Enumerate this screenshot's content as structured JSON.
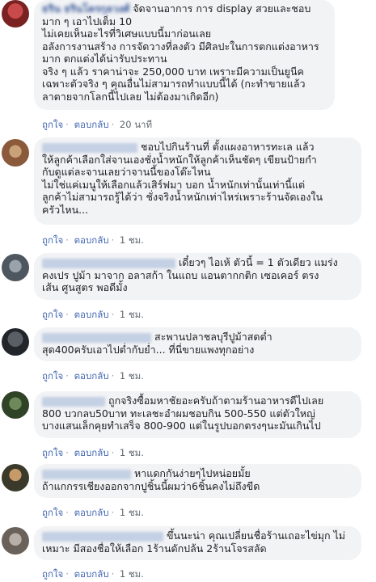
{
  "comments": [
    {
      "author": "ธริน ธรินโครกุลวงศ์",
      "text": "จัดจานอาการ การ display สวยและชอบ\nมาก ๆ เอาไปเต็ม 10\nไม่เคยเห็นอะไรที่วิเศษแบบนี้มาก่อนเลย\nอลังการงานสร้าง การจัดวางที่ลงตัว มีศิลปะในการตกแต่งอาหาร\nมาก ตกแต่งได้น่ารับประทาน\nจริง ๆ แล้ว ราคาน่าจะ 250,000 บาท เพราะมีความเป็นยูนีค\nเฉพาะตัวจริง ๆ คุณอื่นไม่สามารถทำแบบนี้ได้ (กะทำขายแล้ว\nลาตายจากโลกนี้ไปเลย ไม่ต้องมาเกิดอีก)",
      "like": "ถูกใจ",
      "reply": "ตอบกลับ",
      "time": "20 นาที"
    },
    {
      "author": "",
      "text": "ชอบไปกินร้านที่ ตั้งแผงอาหารทะเล แล้ว\nให้ลูกค้าเลือกใส่จานเองชั่งน้ำหนักให้ลูกค้าเห็นชัดๆ เขียนป้ายกำ\nกับดูแต่ละจานเลยว่าจานนี้ของโต๊ะไหน\nไม่ใช่แค่เมนูให้เลือกแล้วเสิร์ฟมา บอก น้ำหนักเท่านั้นเท่านี้แต่\nลูกค้าไม่สามารถรู้ได้ว่า ชั่งจริงน้ำหนักเท่าไหร่เพราะร้านจัดเองใน\nครัวไหน...",
      "like": "ถูกใจ",
      "reply": "ตอบกลับ",
      "time": "1 ชม."
    },
    {
      "author": "",
      "text": "เดี๋ยวๆ ไอเห้ ตัวนี้ = 1 ตัวเดียว แมร่ง\nคงเปร ปูม้า มาจาก อลาสก้า ในแถบ แอนตากกติก เซอเคอร์ ตรง\nเส้น ศูนสูตร พอดีมั้ง",
      "like": "ถูกใจ",
      "reply": "ตอบกลับ",
      "time": "1 ชม."
    },
    {
      "author": "",
      "text": "สะพานปลาชลบุรีปูม้าสดต่ำ\nสุด400ครับเอาไปต่ำกับย่ำ... ที่นี่ขายแพงทุกอย่าง",
      "like": "ถูกใจ",
      "reply": "ตอบกลับ",
      "time": "1 ชม."
    },
    {
      "author": "",
      "text": "ถูกจริงซื้อมหาชัยอะครับถ้าตามร้านอาหารดีไปเลย\n800 บวกลบ50บาท ทะเลชะอำผมชอบกิน 500-550 แต่ตัวใหญ่\nบางแสนเล็กคุยทำเสร็จ 800-900 แต่ในรูปบอกตรงๆนะมันเกินไป",
      "like": "ถูกใจ",
      "reply": "ตอบกลับ",
      "time": "1 ชม."
    },
    {
      "author": "",
      "text": "หาแดกกันง่ายๆไปหน่อยมั้ย\nถ้าแกกรรเชียงออกจากปูชิ้นนี้ผมว่า6ชิ้นคงไม่ถึงขีด",
      "like": "ถูกใจ",
      "reply": "ตอบกลับ",
      "time": "1 ชม."
    },
    {
      "author": "",
      "text": "ขึ้นนะน่า คุณเปลี่ยนชื่อร้านเถอะไข่มุก ไม่\nเหมาะ มีสองชื่อให้เลือก 1ร้านดักปล้น 2ร้านโจรสลัด",
      "like": "ถูกใจ",
      "reply": "ตอบกลับ",
      "time": "1 ชม."
    }
  ]
}
